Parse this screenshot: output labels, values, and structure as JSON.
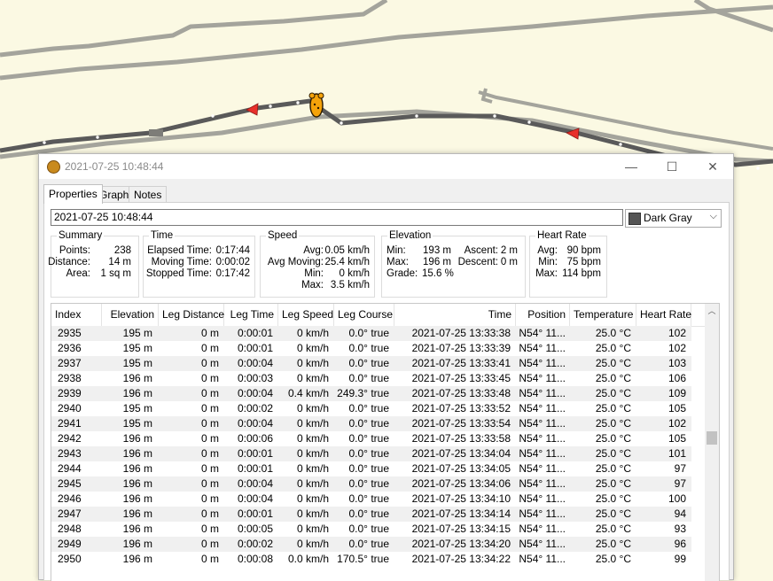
{
  "window": {
    "title": "2021-07-25 10:48:44"
  },
  "tabs": [
    {
      "label": "Properties"
    },
    {
      "label": "Graph"
    },
    {
      "label": "Notes"
    }
  ],
  "name_value": "2021-07-25 10:48:44",
  "color": {
    "label": "Dark Gray",
    "swatch": "#555555"
  },
  "summary": {
    "label": "Summary",
    "points_label": "Points:",
    "points": "238",
    "distance_label": "Distance:",
    "distance": "14 m",
    "area_label": "Area:",
    "area": "1 sq m"
  },
  "time": {
    "label": "Time",
    "elapsed_label": "Elapsed Time:",
    "elapsed": "0:17:44",
    "moving_label": "Moving Time:",
    "moving": "0:00:02",
    "stopped_label": "Stopped Time:",
    "stopped": "0:17:42"
  },
  "speed": {
    "label": "Speed",
    "avg_label": "Avg:",
    "avg": "0.05 km/h",
    "avg_moving_label": "Avg Moving:",
    "avg_moving": "25.4 km/h",
    "min_label": "Min:",
    "min": "0 km/h",
    "max_label": "Max:",
    "max": "3.5 km/h"
  },
  "elevation": {
    "label": "Elevation",
    "min_label": "Min:",
    "min": "193 m",
    "max_label": "Max:",
    "max": "196 m",
    "grade_label": "Grade:",
    "grade": "15.6 %",
    "ascent_label": "Ascent:",
    "ascent": "2 m",
    "descent_label": "Descent:",
    "descent": "0 m"
  },
  "heart_rate": {
    "label": "Heart Rate",
    "avg_label": "Avg:",
    "avg": "90 bpm",
    "min_label": "Min:",
    "min": "75 bpm",
    "max_label": "Max:",
    "max": "114 bpm"
  },
  "table": {
    "columns": [
      "Index",
      "Elevation",
      "Leg Distance",
      "Leg Time",
      "Leg Speed",
      "Leg Course",
      "Time",
      "Position",
      "Temperature",
      "Heart Rate"
    ],
    "rows": [
      [
        "2935",
        "195 m",
        "0 m",
        "0:00:01",
        "0 km/h",
        "0.0° true",
        "2021-07-25 13:33:38",
        "N54° 11...",
        "25.0 °C",
        "102"
      ],
      [
        "2936",
        "195 m",
        "0 m",
        "0:00:01",
        "0 km/h",
        "0.0° true",
        "2021-07-25 13:33:39",
        "N54° 11...",
        "25.0 °C",
        "102"
      ],
      [
        "2937",
        "195 m",
        "0 m",
        "0:00:04",
        "0 km/h",
        "0.0° true",
        "2021-07-25 13:33:41",
        "N54° 11...",
        "25.0 °C",
        "103"
      ],
      [
        "2938",
        "196 m",
        "0 m",
        "0:00:03",
        "0 km/h",
        "0.0° true",
        "2021-07-25 13:33:45",
        "N54° 11...",
        "25.0 °C",
        "106"
      ],
      [
        "2939",
        "196 m",
        "0 m",
        "0:00:04",
        "0.4 km/h",
        "249.3° true",
        "2021-07-25 13:33:48",
        "N54° 11...",
        "25.0 °C",
        "109"
      ],
      [
        "2940",
        "195 m",
        "0 m",
        "0:00:02",
        "0 km/h",
        "0.0° true",
        "2021-07-25 13:33:52",
        "N54° 11...",
        "25.0 °C",
        "105"
      ],
      [
        "2941",
        "195 m",
        "0 m",
        "0:00:04",
        "0 km/h",
        "0.0° true",
        "2021-07-25 13:33:54",
        "N54° 11...",
        "25.0 °C",
        "102"
      ],
      [
        "2942",
        "196 m",
        "0 m",
        "0:00:06",
        "0 km/h",
        "0.0° true",
        "2021-07-25 13:33:58",
        "N54° 11...",
        "25.0 °C",
        "105"
      ],
      [
        "2943",
        "196 m",
        "0 m",
        "0:00:01",
        "0 km/h",
        "0.0° true",
        "2021-07-25 13:34:04",
        "N54° 11...",
        "25.0 °C",
        "101"
      ],
      [
        "2944",
        "196 m",
        "0 m",
        "0:00:01",
        "0 km/h",
        "0.0° true",
        "2021-07-25 13:34:05",
        "N54° 11...",
        "25.0 °C",
        "97"
      ],
      [
        "2945",
        "196 m",
        "0 m",
        "0:00:04",
        "0 km/h",
        "0.0° true",
        "2021-07-25 13:34:06",
        "N54° 11...",
        "25.0 °C",
        "97"
      ],
      [
        "2946",
        "196 m",
        "0 m",
        "0:00:04",
        "0 km/h",
        "0.0° true",
        "2021-07-25 13:34:10",
        "N54° 11...",
        "25.0 °C",
        "100"
      ],
      [
        "2947",
        "196 m",
        "0 m",
        "0:00:01",
        "0 km/h",
        "0.0° true",
        "2021-07-25 13:34:14",
        "N54° 11...",
        "25.0 °C",
        "94"
      ],
      [
        "2948",
        "196 m",
        "0 m",
        "0:00:05",
        "0 km/h",
        "0.0° true",
        "2021-07-25 13:34:15",
        "N54° 11...",
        "25.0 °C",
        "93"
      ],
      [
        "2949",
        "196 m",
        "0 m",
        "0:00:02",
        "0 km/h",
        "0.0° true",
        "2021-07-25 13:34:20",
        "N54° 11...",
        "25.0 °C",
        "96"
      ],
      [
        "2950",
        "196 m",
        "0 m",
        "0:00:08",
        "0.0 km/h",
        "170.5° true",
        "2021-07-25 13:34:22",
        "N54° 11...",
        "25.0 °C",
        "99"
      ]
    ]
  },
  "icons": {
    "app": "track-icon",
    "minimize": "minimize-icon",
    "maximize": "maximize-icon",
    "close": "close-icon",
    "scroll_up": "chevron-up-icon",
    "scroll_down": "chevron-down-icon",
    "direction_arrow": "direction-arrow-icon",
    "waypoint": "bear-waypoint-icon"
  },
  "colors": {
    "map_background": "#fbf9e3",
    "track_light": "#9d9d95",
    "track_selected": "#555555",
    "direction_arrow": "#e8302a",
    "waypoint": "#f5a30a"
  }
}
